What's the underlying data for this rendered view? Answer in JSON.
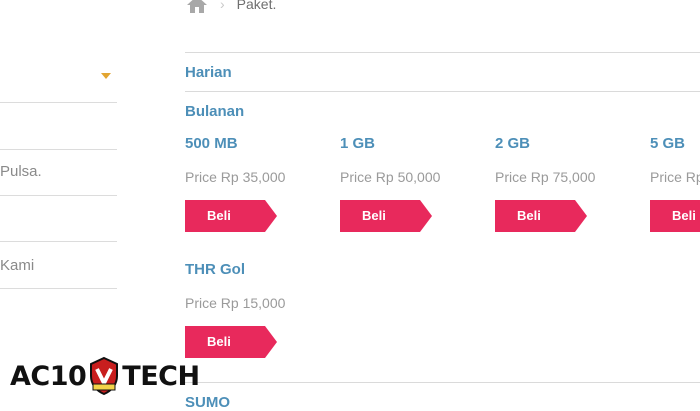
{
  "breadcrumb": {
    "separator": "›",
    "current": "Paket."
  },
  "sidebar": {
    "items": [
      {
        "label": ""
      },
      {
        "label": "Pulsa."
      },
      {
        "label": "Kami"
      }
    ]
  },
  "sections": {
    "harian": "Harian",
    "bulanan": "Bulanan",
    "sumo": "SUMO"
  },
  "packages": [
    {
      "name": "500 MB",
      "price": "Price Rp 35,000",
      "button": "Beli"
    },
    {
      "name": "1 GB",
      "price": "Price Rp 50,000",
      "button": "Beli"
    },
    {
      "name": "2 GB",
      "price": "Price Rp 75,000",
      "button": "Beli"
    },
    {
      "name": "5 GB",
      "price": "Price Rp",
      "button": "Beli"
    },
    {
      "name": "THR Gol",
      "price": "Price Rp 15,000",
      "button": "Beli"
    }
  ],
  "logo": {
    "left": "AC10",
    "right": "TECH",
    "emblem_text": "AC10 Tech"
  },
  "colors": {
    "accent": "#e8295c",
    "title": "#4d8fb8",
    "caret": "#e2a531"
  }
}
